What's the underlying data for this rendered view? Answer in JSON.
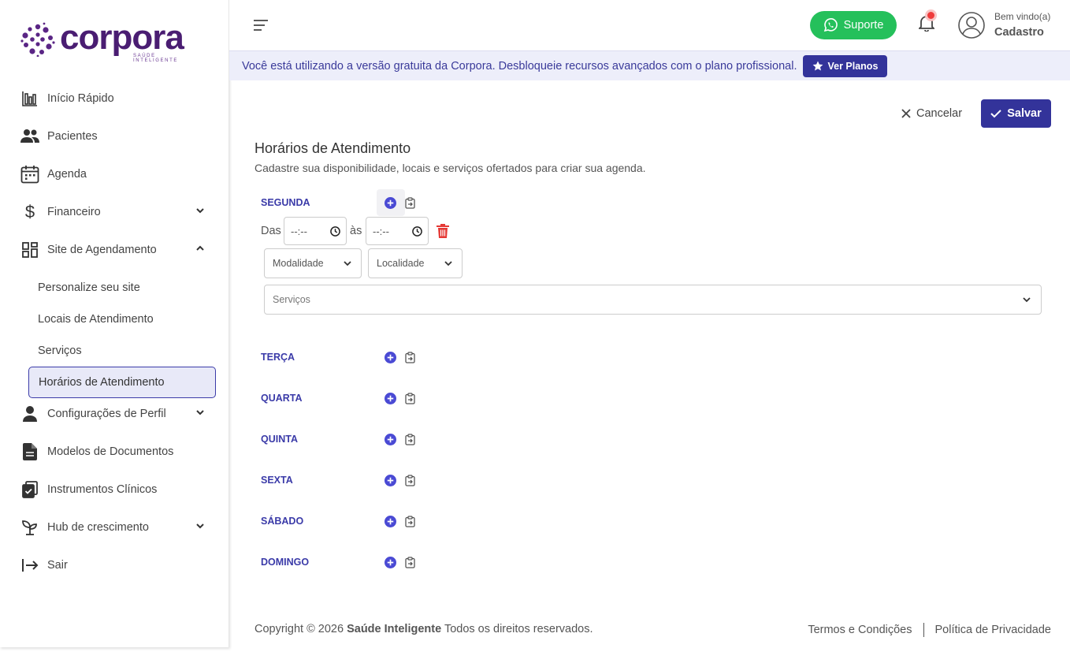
{
  "brand": {
    "name": "corpora",
    "tagline": "SAÚDE INTELIGENTE",
    "color": "#4a1d72"
  },
  "sidebar": {
    "items": [
      {
        "label": "Início Rápido",
        "icon": "bar-chart-icon"
      },
      {
        "label": "Pacientes",
        "icon": "users-icon"
      },
      {
        "label": "Agenda",
        "icon": "calendar-icon"
      },
      {
        "label": "Financeiro",
        "icon": "dollar-icon",
        "expandable": true
      },
      {
        "label": "Site de Agendamento",
        "icon": "grid-icon",
        "expanded": true
      },
      {
        "label": "Configurações de Perfil",
        "icon": "user-icon",
        "expandable": true
      },
      {
        "label": "Modelos de Documentos",
        "icon": "document-icon"
      },
      {
        "label": "Instrumentos Clínicos",
        "icon": "clipboard-check-icon"
      },
      {
        "label": "Hub de crescimento",
        "icon": "sprout-icon",
        "expandable": true
      },
      {
        "label": "Sair",
        "icon": "logout-icon"
      }
    ],
    "subitems": [
      {
        "label": "Personalize seu site"
      },
      {
        "label": "Locais de Atendimento"
      },
      {
        "label": "Serviços"
      },
      {
        "label": "Horários de Atendimento",
        "active": true
      }
    ]
  },
  "topbar": {
    "support_label": "Suporte",
    "support_color": "#25c05b",
    "welcome": "Bem vindo(a)",
    "user_name": "Cadastro"
  },
  "banner": {
    "text": "Você está utilizando a versão gratuita da Corpora. Desbloqueie recursos avançados com o plano profissional.",
    "button_label": "Ver Planos"
  },
  "actions": {
    "cancel_label": "Cancelar",
    "save_label": "Salvar",
    "accent": "#33339a"
  },
  "page": {
    "title": "Horários de Atendimento",
    "subtitle": "Cadastre sua disponibilidade, locais e serviços ofertados para criar sua agenda."
  },
  "schedule": {
    "from_label": "Das",
    "to_label": "às",
    "start_time": "--:--",
    "end_time": "--:--",
    "modality_placeholder": "Modalidade",
    "location_placeholder": "Localidade",
    "services_placeholder": "Serviços",
    "days": [
      "SEGUNDA",
      "TERÇA",
      "QUARTA",
      "QUINTA",
      "SEXTA",
      "SÁBADO",
      "DOMINGO"
    ]
  },
  "footer": {
    "copyright_prefix": "Copyright © 2026",
    "company": "Saúde Inteligente",
    "rights": "Todos os direitos reservados.",
    "terms": "Termos e Condições",
    "privacy": "Política de Privacidade"
  }
}
